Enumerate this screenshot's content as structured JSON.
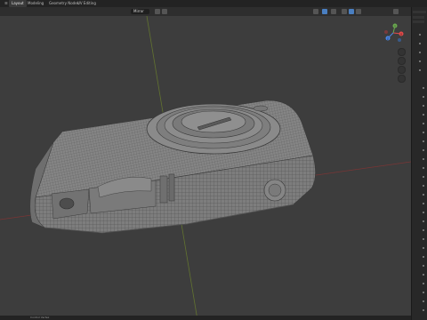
{
  "window": {
    "tabs": [
      {
        "label": "Layout"
      },
      {
        "label": "Modeling"
      },
      {
        "label": "Geometry Nodes"
      },
      {
        "label": "UV Editing"
      }
    ]
  },
  "viewport_header": {
    "mode_label": "Mirror",
    "shading_icons": [
      "solid-shading-icon",
      "material-shading-icon",
      "rendered-shading-icon",
      "wireframe-shading-icon"
    ]
  },
  "navigation_gizmo": {
    "x_label": "X",
    "y_label": "Y",
    "z_label": "Z",
    "x_color": "#e24a4a",
    "y_color": "#6aa84f",
    "z_color": "#4a86e8"
  },
  "status_bar": {
    "text": "Control Vertex"
  },
  "colors": {
    "background": "#3d3d3d",
    "mesh_fill": "#7a7a7a",
    "mesh_wire": "#3a3a3a",
    "x_axis": "#8b3a3a",
    "y_axis": "#6b7d2f"
  }
}
